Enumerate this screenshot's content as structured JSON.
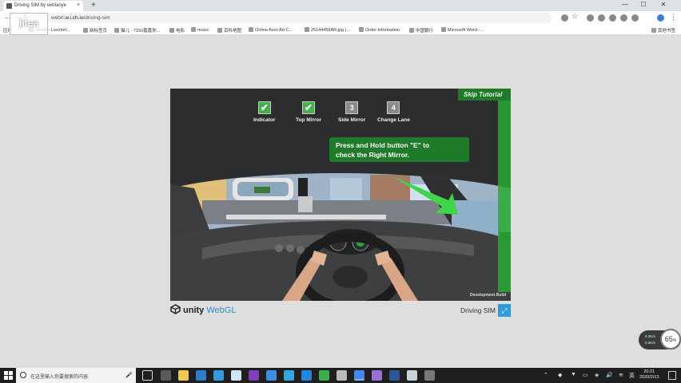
{
  "browser": {
    "tab_title": "Driving SIM by vetrianye",
    "tab_close": "×",
    "new_tab": "+",
    "url_prefix": "webrl",
    "url_host": ".w.i.ch.io",
    "url_path": "/driving-sim",
    "bookmarks_overflow": "其他书签",
    "bookmarks": [
      "应用",
      "Street - Locolrel...",
      "新标签页",
      "猫儿 - 7150嘉嘉你...",
      "电影",
      "music",
      "百科地图",
      "Online Ascii Art C...",
      "25144459AR.jpg (...",
      "Order Information",
      "中国银行",
      "Microsoft Word -..."
    ]
  },
  "watermark": "jitea",
  "game": {
    "skip_label": "Skip Tutorial",
    "checklist": [
      {
        "label": "Indicator",
        "state": "checked",
        "mark": "✔"
      },
      {
        "label": "Top Mirror",
        "state": "checked",
        "mark": "✔"
      },
      {
        "label": "Side Mirror",
        "state": "pending",
        "mark": "3"
      },
      {
        "label": "Change Lane",
        "state": "pending",
        "mark": "4"
      }
    ],
    "instruction_line1": "Press and Hold button \"E\" to",
    "instruction_line2": "check the Right Mirror.",
    "dev_build": "Development Build"
  },
  "footer": {
    "unity": "unity",
    "webgl": "WebGL",
    "title": "Driving SIM",
    "fullscreen_icon": "⤢"
  },
  "widget": {
    "line1": "0.3K/s",
    "line2": "0.3K/s",
    "percent": "65",
    "percent_unit": "%"
  },
  "taskbar": {
    "search_placeholder": "在这里输入你要搜索的内容",
    "time": "20:21",
    "date": "2020/2/13",
    "lang": "英"
  },
  "colors": {
    "tutorial_green": "#1f7a2a",
    "check_green": "#45b049",
    "webgl_blue": "#2f8fd5"
  }
}
